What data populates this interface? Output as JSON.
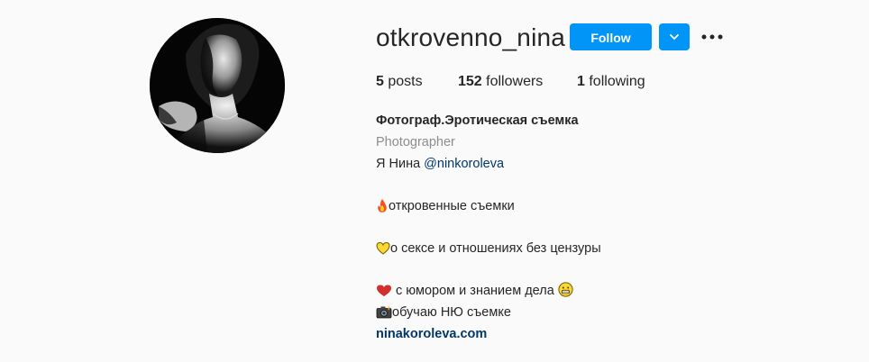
{
  "profile": {
    "username": "otkrovenno_nina",
    "follow_label": "Follow"
  },
  "stats": {
    "posts_count": "5",
    "posts_label": "posts",
    "followers_count": "152",
    "followers_label": "followers",
    "following_count": "1",
    "following_label": "following"
  },
  "bio": {
    "name": "Фотограф.Эротическая съемка",
    "category": "Photographer",
    "intro_text": "Я Нина ",
    "mention": "@ninkoroleva",
    "line_fire": "откровенные съемки",
    "line_yellow_heart": "о сексе и отношениях без цензуры",
    "line_red_heart": " с юмором и знанием дела ",
    "line_camera": "обучаю НЮ съемке",
    "website": "ninakoroleva.com"
  },
  "icons": {
    "fire": "fire-icon",
    "yellow_heart": "yellow-heart-icon",
    "red_heart": "red-heart-icon",
    "grin": "grinning-face-icon",
    "camera": "camera-flash-icon",
    "dropdown": "chevron-down-icon",
    "more": "more-options-icon"
  },
  "colors": {
    "background": "#fafafa",
    "primary_button": "#0095f6",
    "text": "#262626",
    "secondary_text": "#8e8e8e",
    "link": "#00376b"
  }
}
